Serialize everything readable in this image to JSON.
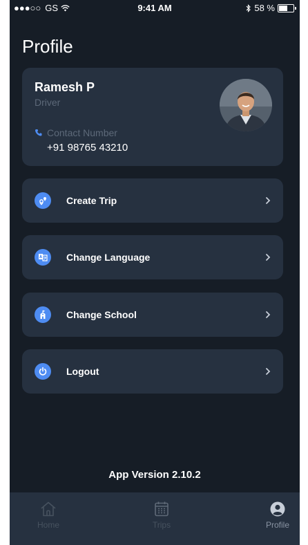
{
  "status_bar": {
    "carrier": "GS",
    "time": "9:41 AM",
    "battery": "58 %",
    "battery_level": 0.58
  },
  "page_title": "Profile",
  "profile": {
    "name": "Ramesh P",
    "role": "Driver",
    "contact_label": "Contact Number",
    "contact_number": "+91 98765 43210"
  },
  "menu": [
    {
      "label": "Create Trip",
      "icon": "create-trip-icon"
    },
    {
      "label": "Change Language",
      "icon": "language-icon"
    },
    {
      "label": "Change School",
      "icon": "school-icon"
    },
    {
      "label": "Logout",
      "icon": "power-icon"
    }
  ],
  "app_version": "App Version 2.10.2",
  "tabs": [
    {
      "label": "Home",
      "icon": "home-icon",
      "active": false
    },
    {
      "label": "Trips",
      "icon": "calendar-icon",
      "active": false
    },
    {
      "label": "Profile",
      "icon": "user-icon",
      "active": true
    }
  ],
  "colors": {
    "background": "#161d26",
    "card": "#263140",
    "accent": "#4e8cf2",
    "muted_text": "#5d6979"
  }
}
